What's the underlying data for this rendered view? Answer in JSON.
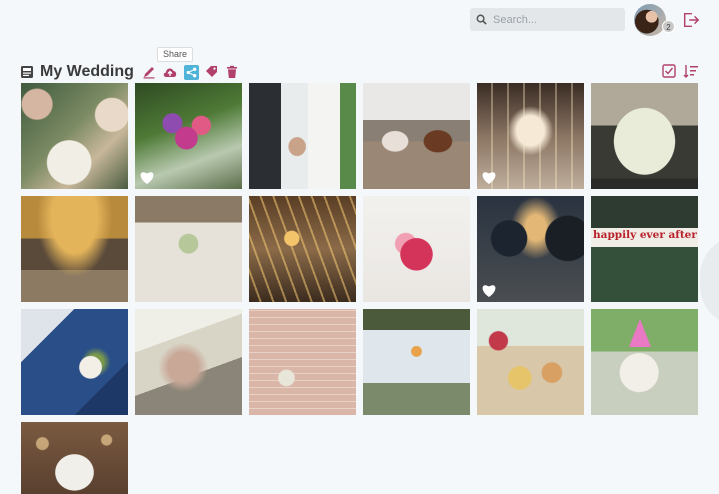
{
  "header": {
    "search_placeholder": "Search...",
    "notification_count": "2"
  },
  "album": {
    "title": "My Wedding",
    "tooltip": "Share"
  },
  "colors": {
    "accent": "#b1416a",
    "share_active": "#4fb4d8",
    "background": "#f4f8fb"
  },
  "icons": {
    "search": "search-icon",
    "logout": "logout-icon",
    "album": "album-icon",
    "edit": "pencil-icon",
    "upload": "cloud-upload-icon",
    "share": "share-icon",
    "tag": "tag-icon",
    "delete": "trash-icon",
    "select": "checkbox-icon",
    "sort": "sort-icon",
    "favorite": "heart-icon"
  },
  "photos": [
    {
      "name": "table-setting",
      "favorite": false
    },
    {
      "name": "flower-bouquet-purple",
      "favorite": true
    },
    {
      "name": "holding-hands",
      "favorite": false
    },
    {
      "name": "couple-shoes",
      "favorite": true
    },
    {
      "name": "string-lights-barn",
      "favorite": true
    },
    {
      "name": "vintage-van",
      "favorite": false
    },
    {
      "name": "autumn-ceremony",
      "favorite": false
    },
    {
      "name": "reception-table",
      "favorite": false
    },
    {
      "name": "toast-lights",
      "favorite": false
    },
    {
      "name": "bridal-bouquet-pink",
      "favorite": false
    },
    {
      "name": "evening-party",
      "favorite": true
    },
    {
      "name": "happily-ever-after-sign",
      "favorite": false
    },
    {
      "name": "car-door-flowers",
      "favorite": false
    },
    {
      "name": "van-window",
      "favorite": false
    },
    {
      "name": "brick-wall-candles",
      "favorite": false
    },
    {
      "name": "beach-toast",
      "favorite": false
    },
    {
      "name": "snack-platter",
      "favorite": false
    },
    {
      "name": "party-dog",
      "favorite": false
    },
    {
      "name": "wedding-cake",
      "favorite": false
    }
  ],
  "sign_text": "happily ever after"
}
